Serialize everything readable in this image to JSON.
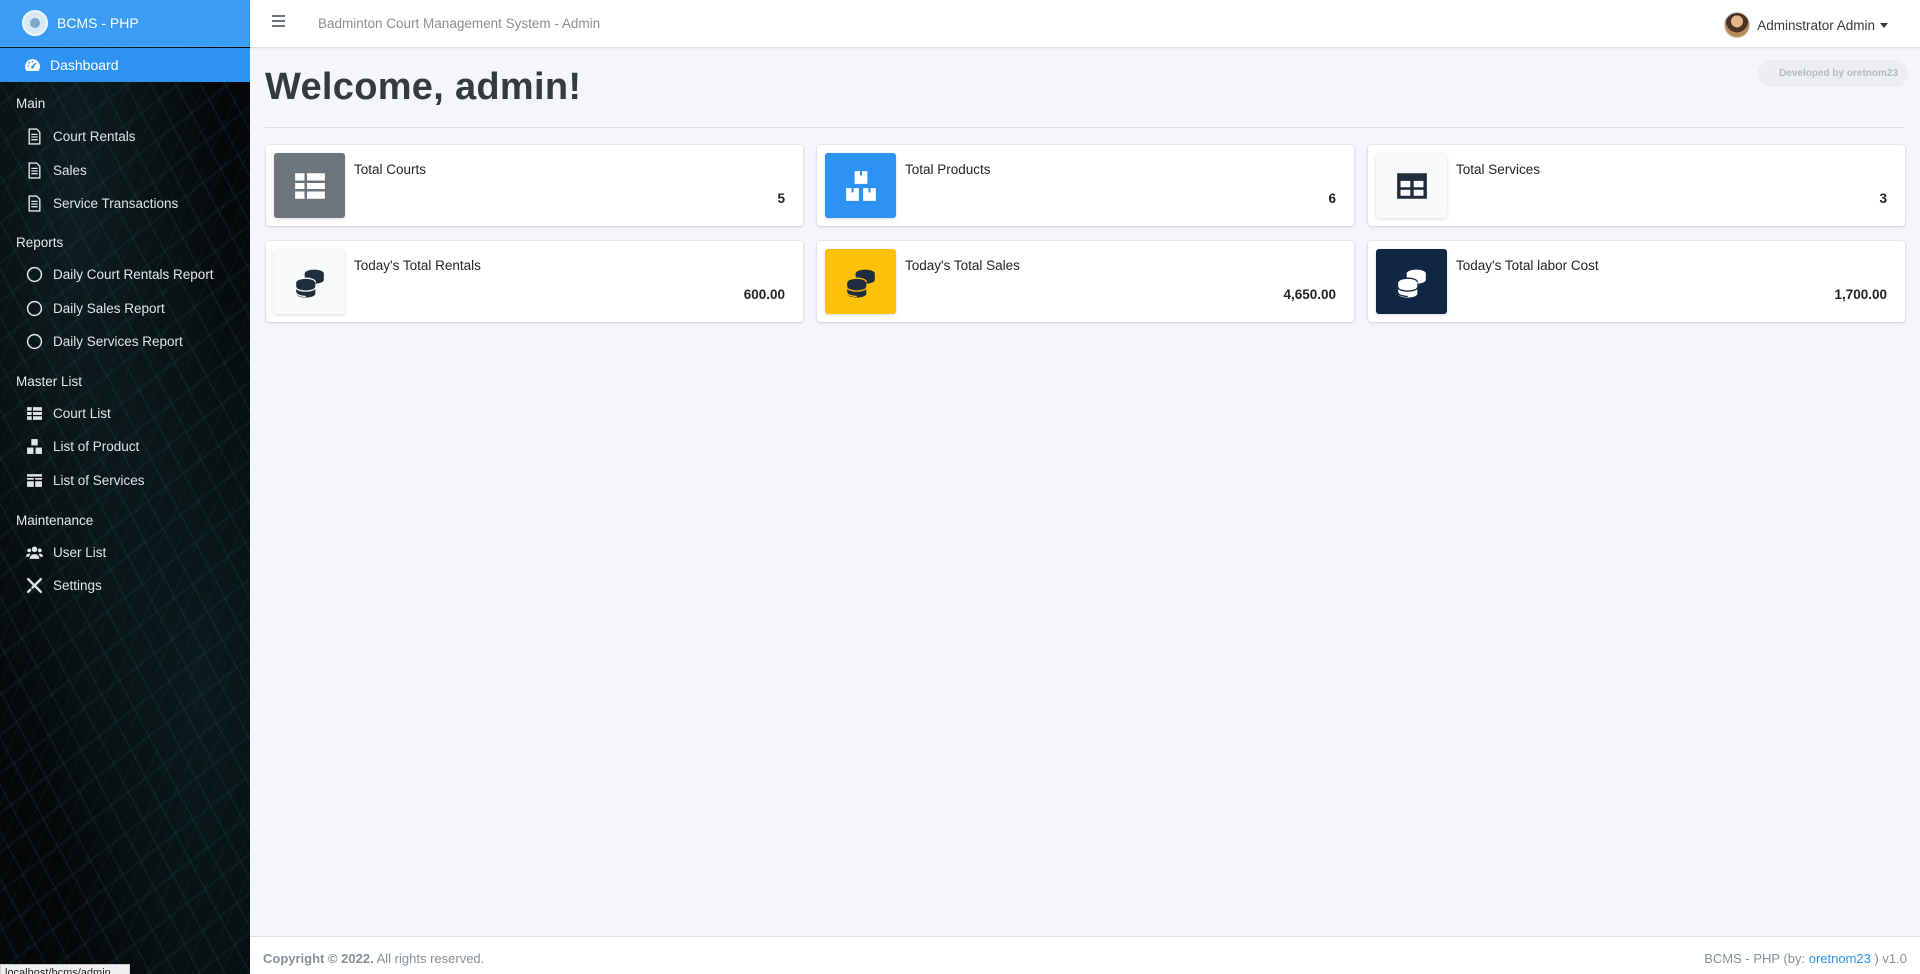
{
  "brand": {
    "name": "BCMS - PHP"
  },
  "sidebar": {
    "active": {
      "label": "Dashboard",
      "icon": "dashboard-icon"
    },
    "sections": [
      {
        "header": "Main",
        "items": [
          {
            "label": "Court Rentals",
            "icon": "file-icon"
          },
          {
            "label": "Sales",
            "icon": "file-icon"
          },
          {
            "label": "Service Transactions",
            "icon": "file-icon"
          }
        ]
      },
      {
        "header": "Reports",
        "items": [
          {
            "label": "Daily Court Rentals Report",
            "icon": "circle-icon"
          },
          {
            "label": "Daily Sales Report",
            "icon": "circle-icon"
          },
          {
            "label": "Daily Services Report",
            "icon": "circle-icon"
          }
        ]
      },
      {
        "header": "Master List",
        "items": [
          {
            "label": "Court List",
            "icon": "table-icon"
          },
          {
            "label": "List of Product",
            "icon": "boxes-icon"
          },
          {
            "label": "List of Services",
            "icon": "grid-icon"
          }
        ]
      },
      {
        "header": "Maintenance",
        "items": [
          {
            "label": "User List",
            "icon": "users-icon"
          },
          {
            "label": "Settings",
            "icon": "tools-icon"
          }
        ]
      }
    ],
    "status_url": "localhost/bcms/admin"
  },
  "topbar": {
    "title": "Badminton Court Management System - Admin",
    "user": "Adminstrator Admin"
  },
  "dev_badge": "Developed by oretnom23",
  "main": {
    "welcome": "Welcome, admin!",
    "cards": [
      {
        "label": "Total Courts",
        "value": "5",
        "icon": "table-icon",
        "bg": "#6c757d",
        "fg": "#ffffff"
      },
      {
        "label": "Total Products",
        "value": "6",
        "icon": "boxes-icon",
        "bg": "#2c93f4",
        "fg": "#ffffff"
      },
      {
        "label": "Total Services",
        "value": "3",
        "icon": "grid-icon",
        "bg": "#f8f9fa",
        "fg": "#1f2d3d"
      },
      {
        "label": "Today's Total Rentals",
        "value": "600.00",
        "icon": "coins-icon",
        "bg": "#f8f9fa",
        "fg": "#1f2d3d"
      },
      {
        "label": "Today's Total Sales",
        "value": "4,650.00",
        "icon": "coins-icon",
        "bg": "#ffc107",
        "fg": "#1f2d3d"
      },
      {
        "label": "Today's Total labor Cost",
        "value": "1,700.00",
        "icon": "coins-icon",
        "bg": "#0f2744",
        "fg": "#ffffff"
      }
    ]
  },
  "footer": {
    "copyright": "Copyright © 2022.",
    "rights": " All rights reserved.",
    "right_prefix": "BCMS - PHP (by: ",
    "right_link": "oretnom23",
    "right_suffix": " ) v1.0"
  }
}
